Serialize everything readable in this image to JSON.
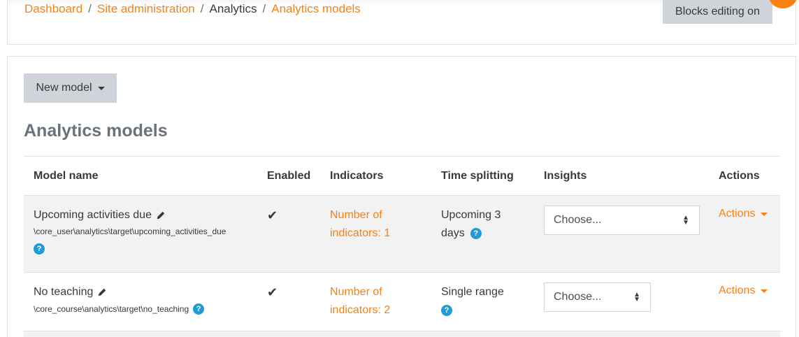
{
  "breadcrumb": {
    "items": [
      "Dashboard",
      "Site administration",
      "Analytics",
      "Analytics models"
    ],
    "separator": "/"
  },
  "header": {
    "blocks_editing_label": "Blocks editing on"
  },
  "toolbar": {
    "new_model_label": "New model"
  },
  "page_title": "Analytics models",
  "table": {
    "headers": [
      "Model name",
      "Enabled",
      "Indicators",
      "Time splitting",
      "Insights",
      "Actions"
    ],
    "rows": [
      {
        "name": "Upcoming activities due",
        "path": "\\core_user\\analytics\\target\\upcoming_activities_due",
        "enabled": "✔",
        "indicators_line1": "Number of",
        "indicators_line2": "indicators: 1",
        "time_splitting_line1": "Upcoming 3",
        "time_splitting_line2": "days",
        "insights_value": "Choose...",
        "actions_label": "Actions"
      },
      {
        "name": "No teaching",
        "path": "\\core_course\\analytics\\target\\no_teaching",
        "enabled": "✔",
        "indicators_line1": "Number of",
        "indicators_line2": "indicators: 2",
        "time_splitting_line1": "Single range",
        "time_splitting_line2": "",
        "insights_value": "Choose...",
        "actions_label": "Actions"
      }
    ]
  },
  "icons": {
    "help": "question-circle-icon",
    "edit": "pencil-icon",
    "check": "check-icon"
  },
  "colors": {
    "link": "#f98012",
    "help": "#1f9bd8",
    "button_bg": "#ced4da",
    "striped_row": "#f2f2f2",
    "title": "#6a737b"
  }
}
